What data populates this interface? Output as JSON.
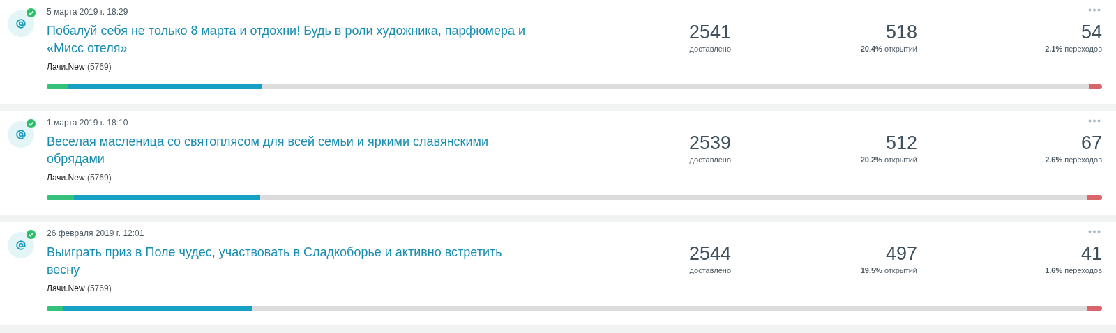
{
  "campaigns": [
    {
      "date": "5 марта 2019 г. 18:29",
      "verified": true,
      "title": "Побалуй себя не только 8 марта и отдохни! Будь в роли художника, парфюмера и «Мисс отеля»",
      "list": "Лачи.New",
      "count": "(5769)",
      "delivered": {
        "value": "2541",
        "label": "доставлено"
      },
      "opens": {
        "value": "518",
        "percent": "20.4%",
        "label": "открытий"
      },
      "clicks": {
        "value": "54",
        "percent": "2.1%",
        "label": "переходов"
      },
      "bar": {
        "green": {
          "level": 0.02
        },
        "blue": {
          "level": 0.204
        },
        "red": {
          "level": 0.012
        }
      }
    },
    {
      "date": "1 марта 2019 г. 18:10",
      "verified": true,
      "title": "Веселая масленица со святоплясом для всей семьи и яркими славянскими обрядами",
      "list": "Лачи.New",
      "count": "(5769)",
      "delivered": {
        "value": "2539",
        "label": "доставлено"
      },
      "opens": {
        "value": "512",
        "percent": "20.2%",
        "label": "открытий"
      },
      "clicks": {
        "value": "67",
        "percent": "2.6%",
        "label": "переходов"
      },
      "bar": {
        "green": {
          "level": 0.026
        },
        "blue": {
          "level": 0.202
        },
        "red": {
          "level": 0.014
        }
      }
    },
    {
      "date": "26 февраля 2019 г. 12:01",
      "verified": true,
      "title": "Выиграть приз в Поле чудес, участвовать в Сладкоборье и активно встретить весну",
      "list": "Лачи.New",
      "count": "(5769)",
      "delivered": {
        "value": "2544",
        "label": "доставлено"
      },
      "opens": {
        "value": "497",
        "percent": "19.5%",
        "label": "открытий"
      },
      "clicks": {
        "value": "41",
        "percent": "1.6%",
        "label": "переходов"
      },
      "bar": {
        "green": {
          "level": 0.016
        },
        "blue": {
          "level": 0.195
        },
        "red": {
          "level": 0.014
        }
      }
    }
  ]
}
